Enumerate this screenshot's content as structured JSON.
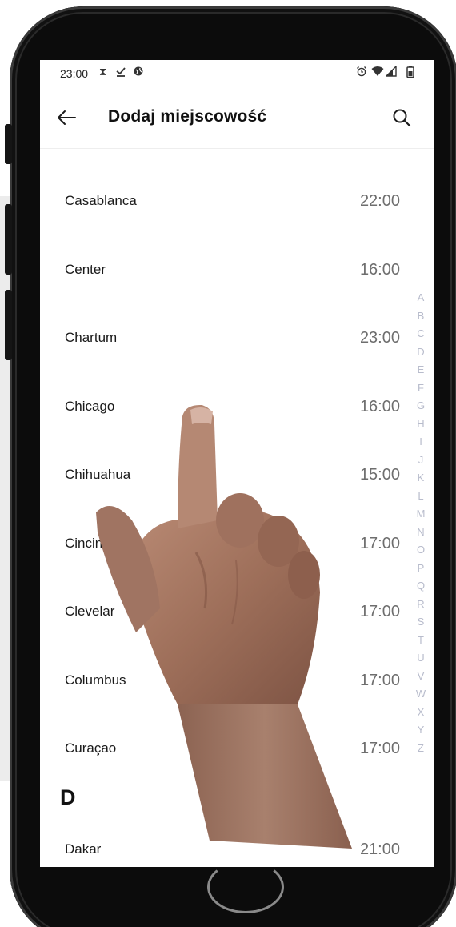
{
  "status_bar": {
    "time": "23:00",
    "left_icons": [
      "hourglass-icon",
      "download-check-icon",
      "globe-icon"
    ],
    "right_icons": [
      "alarm-icon",
      "wifi-icon",
      "signal-icon",
      "battery-icon"
    ]
  },
  "appbar": {
    "title": "Dodaj miejscowość"
  },
  "cities": [
    {
      "name": "Casablanca",
      "time": "22:00"
    },
    {
      "name": "Center",
      "time": "16:00"
    },
    {
      "name": "Chartum",
      "time": "23:00"
    },
    {
      "name": "Chicago",
      "time": "16:00"
    },
    {
      "name": "Chihuahua",
      "time": "15:00"
    },
    {
      "name": "Cincinn",
      "time": "17:00"
    },
    {
      "name": "Clevelar",
      "time": "17:00"
    },
    {
      "name": "Columbus",
      "time": "17:00"
    },
    {
      "name": "Curaçao",
      "time": "17:00"
    },
    {
      "name": "Dakar",
      "time": "21:00"
    }
  ],
  "section_header": "D",
  "index_letters": [
    "A",
    "B",
    "C",
    "D",
    "E",
    "F",
    "G",
    "H",
    "I",
    "J",
    "K",
    "L",
    "M",
    "N",
    "O",
    "P",
    "Q",
    "R",
    "S",
    "T",
    "U",
    "V",
    "W",
    "X",
    "Y",
    "Z"
  ],
  "colors": {
    "index_letter": "#b8bccc",
    "time_text": "#6e6e6e",
    "phone_frame": "#0c0c0c"
  }
}
